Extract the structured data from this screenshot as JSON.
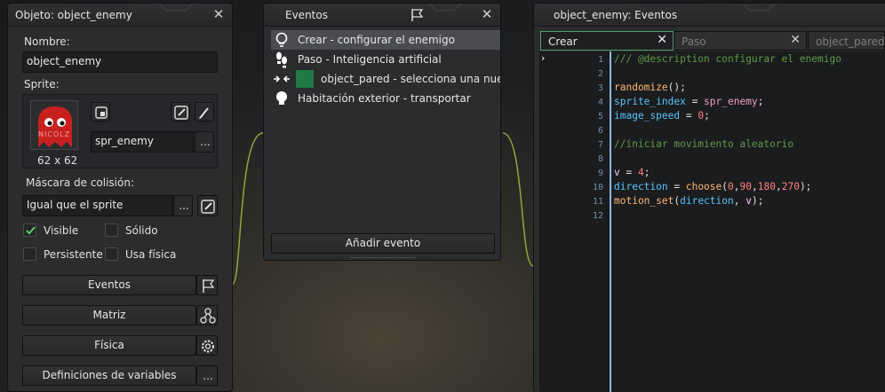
{
  "object_window": {
    "title": "Objeto: object_enemy",
    "name_label": "Nombre:",
    "name_value": "object_enemy",
    "sprite_label": "Sprite:",
    "sprite_name": "spr_enemy",
    "sprite_size": "62 x 62",
    "sprite_caption": "NICOLZ",
    "collision_label": "Máscara de colisión:",
    "collision_value": "Igual que el sprite",
    "checkboxes": [
      {
        "label": "Visible",
        "checked": true
      },
      {
        "label": "Sólido",
        "checked": false
      },
      {
        "label": "Persistente",
        "checked": false
      },
      {
        "label": "Usa física",
        "checked": false
      }
    ],
    "buttons": {
      "events": "Eventos",
      "parent": "Matriz",
      "physics": "Física",
      "variables": "Definiciones de variables",
      "more": "..."
    }
  },
  "events_window": {
    "title": "Eventos",
    "events": [
      {
        "label": "Crear - configurar el enemigo",
        "icon": "lightbulb-icon",
        "selected": true
      },
      {
        "label": "Paso - Inteligencia artificial",
        "icon": "footsteps-icon",
        "selected": false
      },
      {
        "label": "object_pared - selecciona una nueva",
        "icon": "collision-icon",
        "selected": false
      },
      {
        "label": "Habitación exterior - transportar",
        "icon": "bulb-icon",
        "selected": false
      }
    ],
    "add_event": "Añadir evento"
  },
  "code_window": {
    "title": "object_enemy: Eventos",
    "tabs": [
      {
        "label": "Crear",
        "active": true
      },
      {
        "label": "Paso",
        "active": false
      },
      {
        "label": "object_pared",
        "active": false
      }
    ],
    "line_numbers": [
      "1",
      "2",
      "3",
      "4",
      "5",
      "6",
      "7",
      "8",
      "9",
      "10",
      "11",
      "12"
    ],
    "code_lines": [
      "/// @description configurar el enemigo",
      "",
      "randomize();",
      "sprite_index = spr_enemy;",
      "image_speed = 0;",
      "",
      "//iniciar movimiento aleatorio",
      "",
      "v = 4;",
      "direction = choose(0,90,180,270);",
      "motion_set(direction, v);",
      ""
    ]
  },
  "colors": {
    "accent": "#5fd06b",
    "selection": "#4a4c52",
    "tab_active_border": "#4fa06a",
    "connector": "#a8c83c"
  }
}
